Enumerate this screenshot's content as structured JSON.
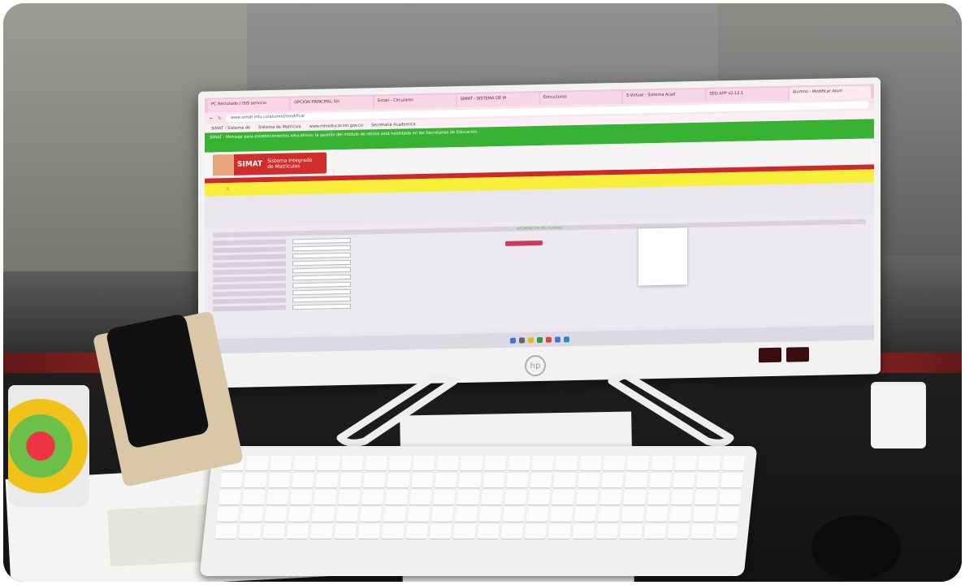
{
  "browser": {
    "tabs": [
      "PC Reclutado / ISIS servicio",
      "OPCION PRINCIPAL Sis",
      "Gmail - Circulares",
      "SIMAT - SISTEMA DE M",
      "Estructuras",
      "E-Virtual - Sistema Acad",
      "SED APP v2.12.1",
      "Alumno - Modificar Alum"
    ],
    "address": "www.simat.edu.co/alumno/modificar",
    "bookmarks": [
      "SIMAT - Sistema de",
      "Sistema de Matricula",
      "www.mineducacion.gov.co",
      "Secretaria Academica"
    ]
  },
  "banner_text": "SIMAT - Mensaje para establecimientos educativos: la gestión del módulo de retiros está habilitada en las Secretarías de Educación.",
  "header": {
    "logo_brand": "SIMAT",
    "logo_subtitle_1": "Sistema Integrado",
    "logo_subtitle_2": "de Matrículas"
  },
  "section_title": "INFORMACION DEL ALUMNO",
  "colors": {
    "banner": "#37b233",
    "accent": "#cc2a2a",
    "warning": "#f7ef3a",
    "tabbar": "#f3c6da"
  }
}
